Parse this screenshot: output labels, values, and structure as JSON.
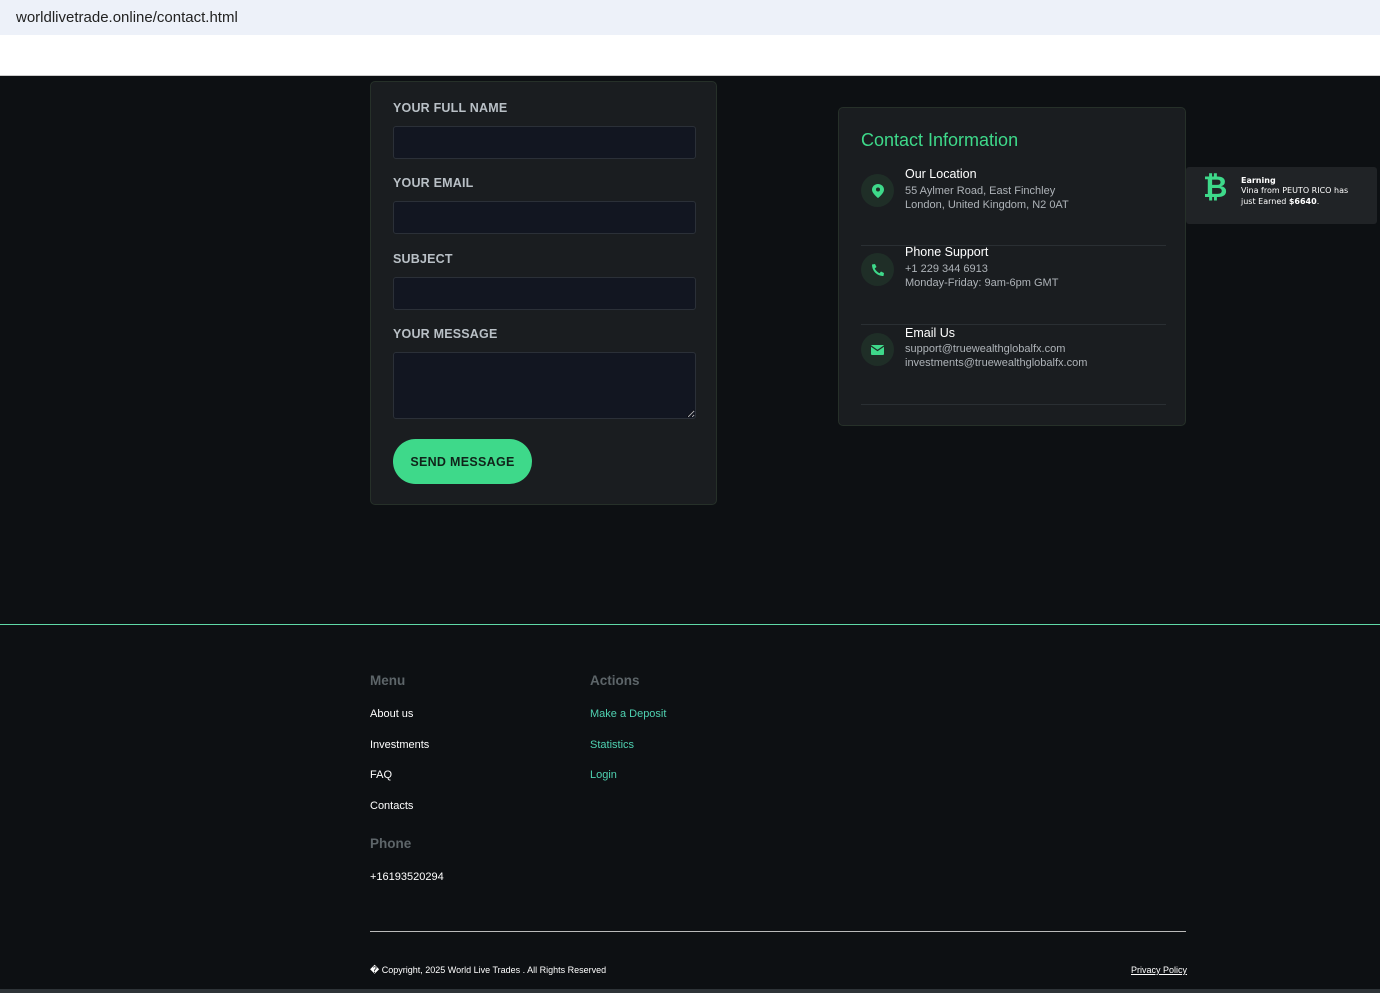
{
  "browser": {
    "url": "worldlivetrade.online/contact.html"
  },
  "form": {
    "name_label": "YOUR FULL NAME",
    "email_label": "YOUR EMAIL",
    "subject_label": "SUBJECT",
    "message_label": "YOUR MESSAGE",
    "name_value": "",
    "email_value": "",
    "subject_value": "",
    "message_value": "",
    "send_label": "SEND MESSAGE"
  },
  "contact": {
    "title": "Contact Information",
    "location": {
      "title": "Our Location",
      "line1": "55 Aylmer Road, East Finchley",
      "line2": "London, United Kingdom, N2 0AT"
    },
    "phone": {
      "title": "Phone Support",
      "line1": "+1 229 344 6913",
      "line2": "Monday-Friday: 9am-6pm GMT"
    },
    "email": {
      "title": "Email Us",
      "line1": "support@truewealthglobalfx.com",
      "line2": "investments@truewealthglobalfx.com"
    }
  },
  "toast": {
    "title": "Earning",
    "line1": "Vina from PEUTO RICO has",
    "line2_prefix": "just Earned ",
    "amount": "$6640",
    "suffix": "."
  },
  "footer": {
    "menu_title": "Menu",
    "menu": [
      "About us",
      "Investments",
      "FAQ",
      "Contacts"
    ],
    "actions_title": "Actions",
    "actions": [
      "Make a Deposit",
      "Statistics",
      "Login"
    ],
    "phone_title": "Phone",
    "phone": "+16193520294",
    "copyright": "� Copyright, 2025 World Live Trades . All Rights Reserved",
    "privacy": "Privacy Policy"
  },
  "colors": {
    "accent": "#3ed98a",
    "background": "#0d1013",
    "card": "#1a1d20"
  }
}
